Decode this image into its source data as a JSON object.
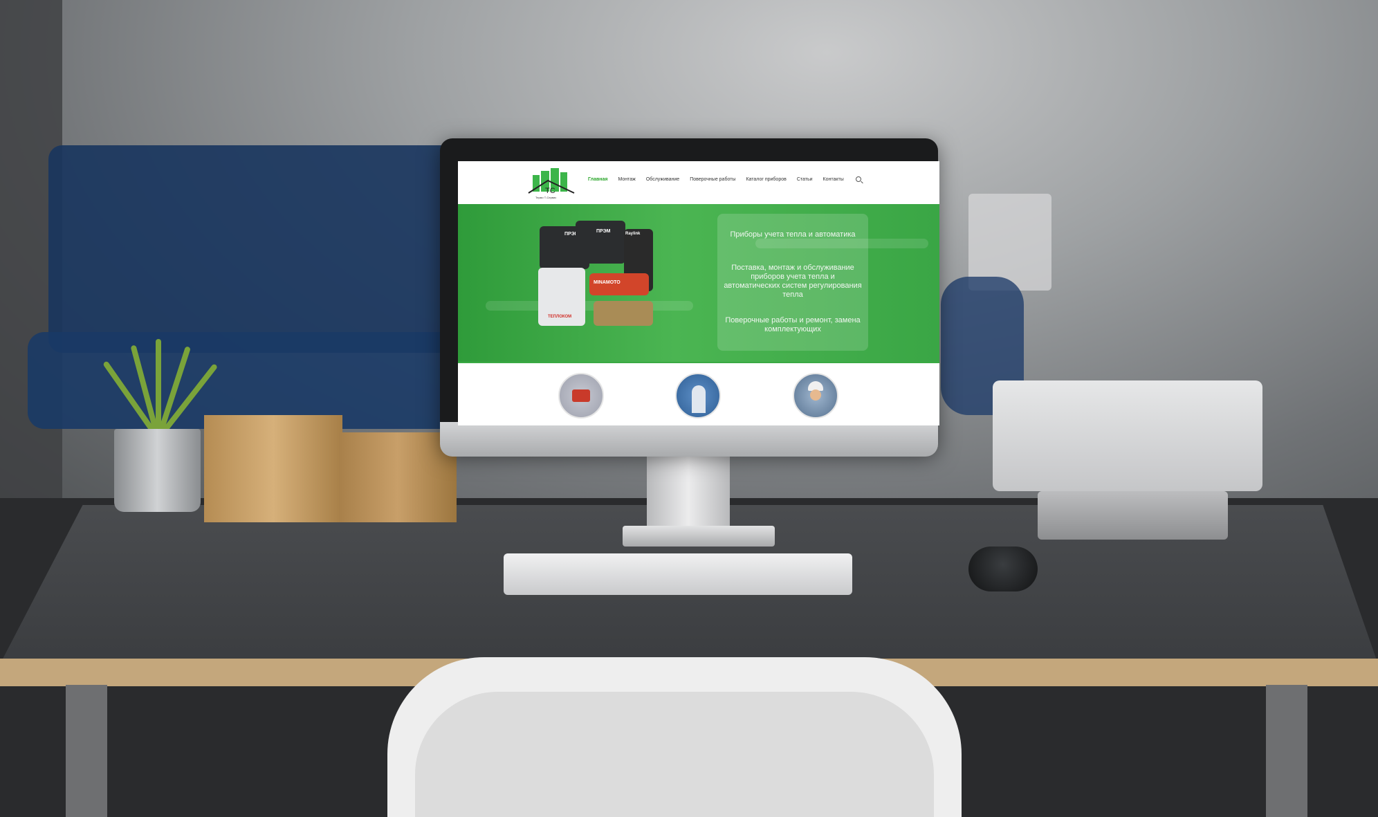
{
  "site": {
    "logo_caption": "Термо Т-Сервис",
    "nav": [
      "Главная",
      "Монтаж",
      "Обслуживание",
      "Поверочные работы",
      "Каталог приборов",
      "Статьи",
      "Контакты"
    ],
    "hero": {
      "line1": "Приборы учета тепла и автоматика",
      "line2": "Поставка, монтаж и обслуживание приборов учета тепла и автоматических систем регулирования тепла",
      "line3": "Поверочные работы и ремонт, замена комплектующих"
    },
    "device_labels": [
      "ПРЭМ",
      "ПРЭМ",
      "Raylink",
      "MINAMOTO",
      "ТЕПЛОКОМ"
    ]
  },
  "colors": {
    "brand_green": "#3aa645",
    "nav_active": "#2aa52a"
  },
  "icons": [
    "apple-logo-icon",
    "search-icon",
    "logo-icon"
  ]
}
